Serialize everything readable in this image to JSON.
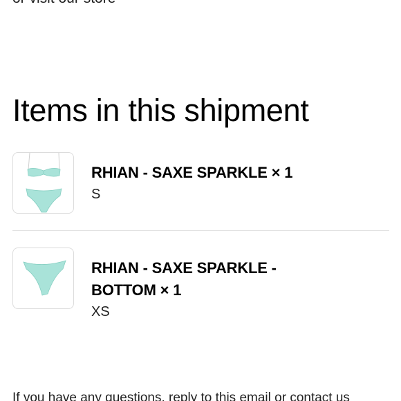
{
  "header": {
    "store_link_text": "or visit our store"
  },
  "shipment": {
    "title": "Items in this shipment",
    "items": [
      {
        "name": "RHIAN - SAXE SPARKLE × 1",
        "variant": "S",
        "thumbnail_icon": "bikini-set-image"
      },
      {
        "name": "RHIAN - SAXE SPARKLE - BOTTOM × 1",
        "variant": "XS",
        "thumbnail_icon": "bikini-bottom-image"
      }
    ]
  },
  "footer": {
    "questions_text": "If you have any questions, reply to this email or contact us"
  },
  "colors": {
    "product_mint": "#a9e3d9",
    "product_mint_dark": "#86cfc2",
    "divider": "#e1e1e1"
  }
}
